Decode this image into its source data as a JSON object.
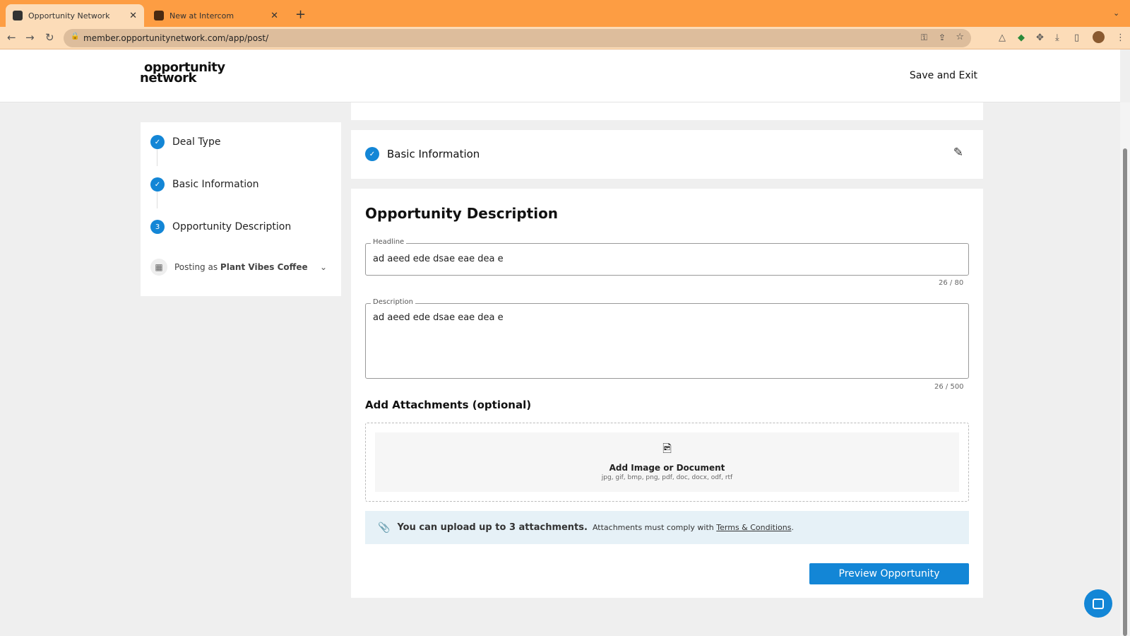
{
  "browser": {
    "tabs": [
      {
        "title": "Opportunity Network",
        "active": true
      },
      {
        "title": "New at Intercom",
        "active": false
      }
    ],
    "url": "member.opportunitynetwork.com/app/post/"
  },
  "header": {
    "logo_line1": "opportunity",
    "logo_line2": "network",
    "save_exit": "Save and Exit"
  },
  "sidebar": {
    "steps": [
      {
        "label": "Deal Type",
        "status": "done"
      },
      {
        "label": "Basic Information",
        "status": "done"
      },
      {
        "label": "Opportunity Description",
        "status": "current",
        "number": "3"
      }
    ],
    "posting_prefix": "Posting as",
    "posting_company": "Plant Vibes Coffee"
  },
  "basic_info": {
    "title": "Basic Information"
  },
  "form": {
    "title": "Opportunity Description",
    "headline_label": "Headline",
    "headline_value": "ad aeed ede dsae eae dea e",
    "headline_count": "26 / 80",
    "description_label": "Description",
    "description_value": "ad aeed ede dsae eae dea e",
    "description_count": "26 / 500",
    "attachments_title": "Add Attachments (optional)",
    "upload_title": "Add Image or Document",
    "upload_formats": "jpg, gif, bmp, png, pdf, doc, docx, odf, rtf",
    "info_bold": "You can upload up to 3 attachments.",
    "info_text": "Attachments must comply with",
    "info_link": "Terms & Conditions",
    "info_end": ".",
    "preview_button": "Preview Opportunity"
  },
  "colors": {
    "accent": "#1386d6",
    "tabbar": "#fd9d43"
  }
}
